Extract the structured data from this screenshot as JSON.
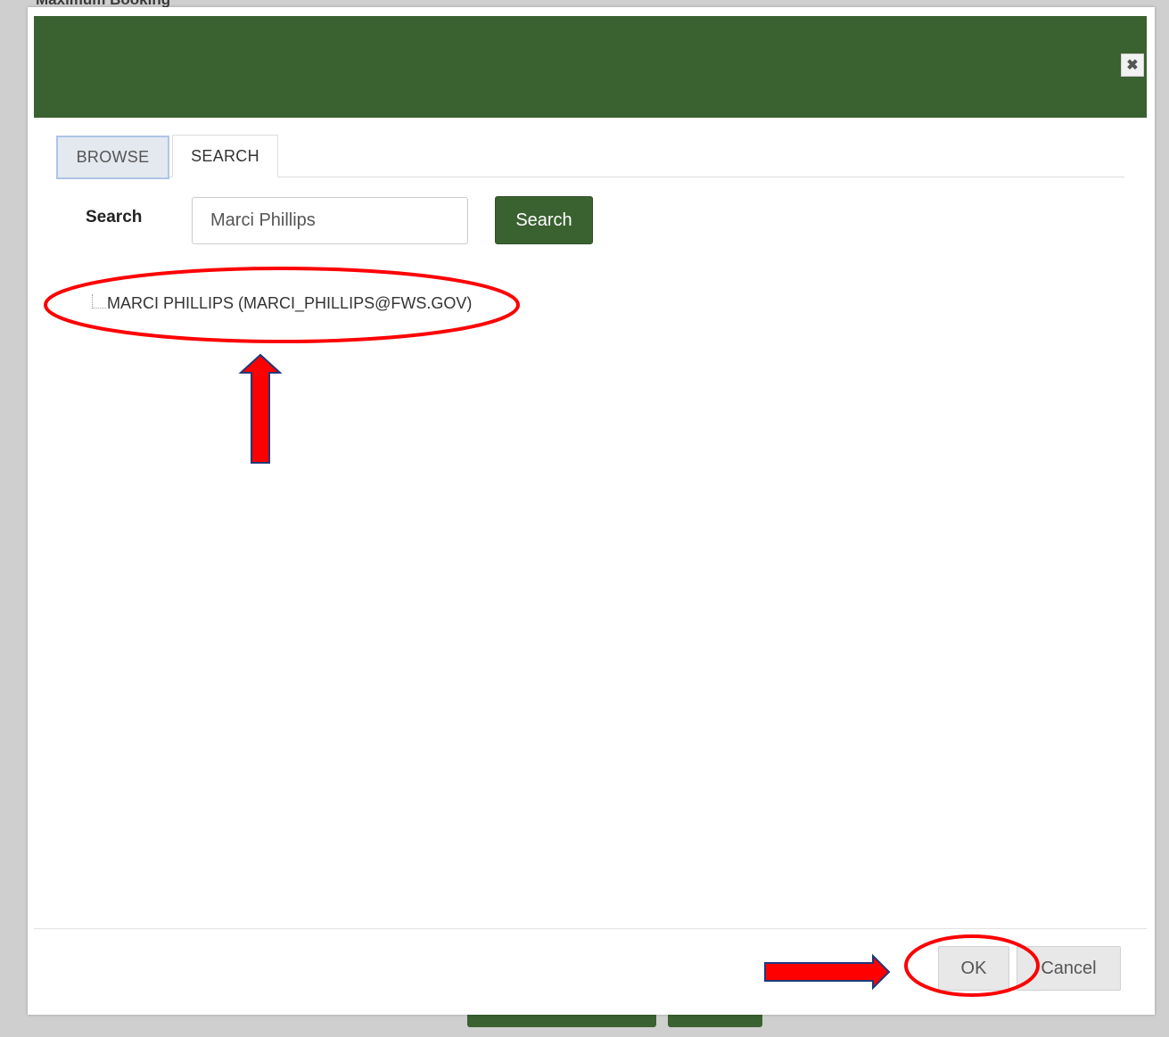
{
  "background": {
    "label": "Maximum Booking"
  },
  "dialog": {
    "tabs": [
      {
        "label": "BROWSE"
      },
      {
        "label": "SEARCH"
      }
    ],
    "search": {
      "label": "Search",
      "value": "Marci Phillips",
      "button_label": "Search"
    },
    "results": [
      {
        "label": "MARCI PHILLIPS (MARCI_PHILLIPS@FWS.GOV)"
      }
    ],
    "footer": {
      "ok_label": "OK",
      "cancel_label": "Cancel"
    }
  },
  "colors": {
    "header_green": "#3a6130",
    "annotation_red": "#ff0000"
  },
  "icons": {
    "close": "close-icon",
    "tree": "tree-connector-icon"
  }
}
